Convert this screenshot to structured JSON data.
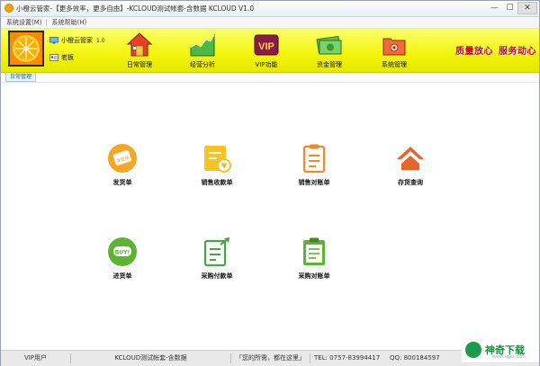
{
  "window": {
    "title": "小橙云管家-【更多效率，更多自由】-KCLOUD测试帐套-含数据  KCLOUD V1.0",
    "controls": {
      "minimize": "—",
      "maximize": "☐",
      "close": "✕"
    }
  },
  "menu": {
    "items": [
      {
        "label": "系统设置(M)"
      },
      {
        "label": "系统帮助(H)"
      }
    ]
  },
  "account": {
    "name": "小橙云管家",
    "version": "1.0",
    "role": "老板"
  },
  "toolbar": {
    "daily": "日常管理",
    "analysis": "经营分析",
    "vip": "VIP功能",
    "funds": "资金管理",
    "system": "系统管理",
    "vip_badge": "VIP"
  },
  "slogans": {
    "quality": "质量放心",
    "service": "服务动心"
  },
  "tab": {
    "active": "日常管理"
  },
  "functions": {
    "delivery": "发货单",
    "sales_receipt": "销售收款单",
    "sales_statement": "销售对账单",
    "stock_query": "存货查询",
    "purchase_order": "进货单",
    "purchase_payment": "采购付款单",
    "purchase_statement": "采购对账单",
    "delivery_icon_text": "发货单",
    "purchase_icon_text": "BUY!"
  },
  "status": {
    "user": "VIP用户",
    "account_set": "KCLOUD测试帐套-含数据",
    "motto": "「您的所需，都在这里」",
    "tel": "TEL: 0757-83994417",
    "qq": "QQ: 800184597"
  },
  "watermark": {
    "brand": "神奇下载",
    "site": "www.sqxz.com"
  },
  "colors": {
    "toolbar_yellow": "#f3f40a",
    "slogan_red": "#c9001a",
    "logo_orange": "#ff8a00",
    "watermark_green": "#1c9a4a"
  }
}
